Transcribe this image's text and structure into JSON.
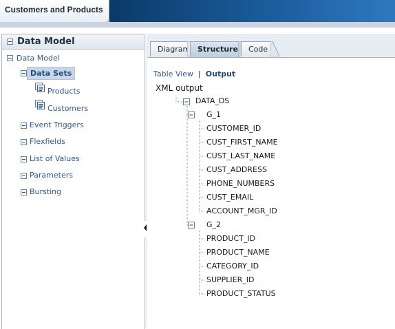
{
  "window": {
    "title": "Customers and Products"
  },
  "left_panel": {
    "title": "Data Model",
    "tree": {
      "root": "Data Model",
      "data_sets_label": "Data Sets",
      "data_sets": [
        "Products",
        "Customers"
      ],
      "other_items": [
        "Event Triggers",
        "Flexfields",
        "List of Values",
        "Parameters",
        "Bursting"
      ]
    }
  },
  "right_panel": {
    "tabs": [
      {
        "label": "Diagram",
        "active": false
      },
      {
        "label": "Structure",
        "active": true
      },
      {
        "label": "Code",
        "active": false
      }
    ],
    "view_toggle": {
      "table_view": "Table View",
      "separator": "|",
      "output": "Output"
    },
    "xml_output_label": "XML output",
    "structure": {
      "root": "DATA_DS",
      "groups": [
        {
          "name": "G_1",
          "fields": [
            "CUSTOMER_ID",
            "CUST_FIRST_NAME",
            "CUST_LAST_NAME",
            "CUST_ADDRESS",
            "PHONE_NUMBERS",
            "CUST_EMAIL",
            "ACCOUNT_MGR_ID"
          ]
        },
        {
          "name": "G_2",
          "fields": [
            "PRODUCT_ID",
            "PRODUCT_NAME",
            "CATEGORY_ID",
            "SUPPLIER_ID",
            "PRODUCT_STATUS"
          ]
        }
      ]
    }
  },
  "colors": {
    "header_blue": "#1a5c9c",
    "link_blue": "#2f5b8a",
    "selected_bg": "#c7d6e8"
  },
  "icons": [
    "collapse-icon",
    "data-set-icon",
    "splitter-arrow-icon"
  ]
}
